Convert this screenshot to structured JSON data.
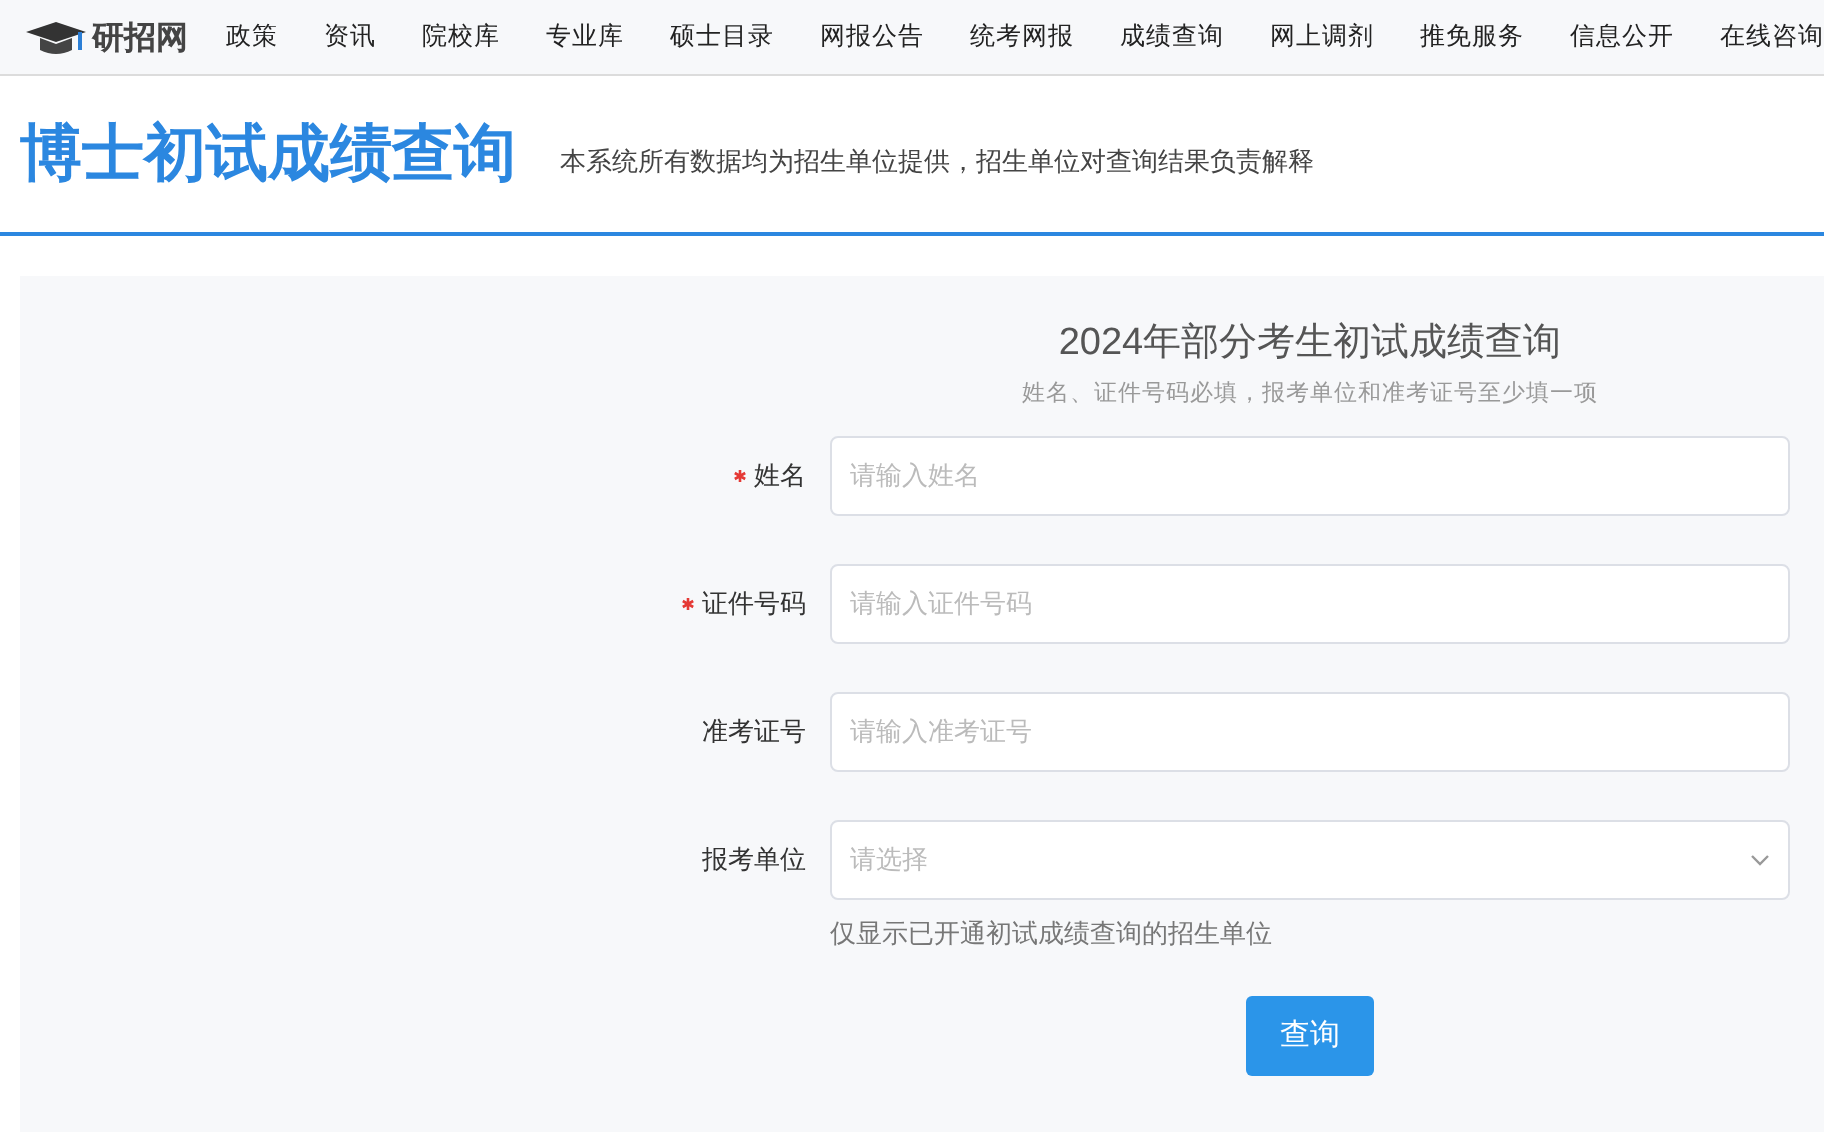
{
  "nav": {
    "logo": "研招网",
    "items": [
      "政策",
      "资讯",
      "院校库",
      "专业库",
      "硕士目录",
      "网报公告",
      "统考网报",
      "成绩查询",
      "网上调剂",
      "推免服务",
      "信息公开",
      "在线咨询"
    ]
  },
  "header": {
    "title": "博士初试成绩查询",
    "note": "本系统所有数据均为招生单位提供，招生单位对查询结果负责解释"
  },
  "form": {
    "title": "2024年部分考生初试成绩查询",
    "subtitle": "姓名、证件号码必填，报考单位和准考证号至少填一项",
    "fields": [
      {
        "kind": "text",
        "label": "姓名",
        "required": true,
        "placeholder": "请输入姓名"
      },
      {
        "kind": "text",
        "label": "证件号码",
        "required": true,
        "placeholder": "请输入证件号码"
      },
      {
        "kind": "text",
        "label": "准考证号",
        "required": false,
        "placeholder": "请输入准考证号"
      },
      {
        "kind": "select",
        "label": "报考单位",
        "required": false,
        "placeholder": "请选择",
        "hint": "仅显示已开通初试成绩查询的招生单位"
      }
    ],
    "submit": "查询"
  }
}
